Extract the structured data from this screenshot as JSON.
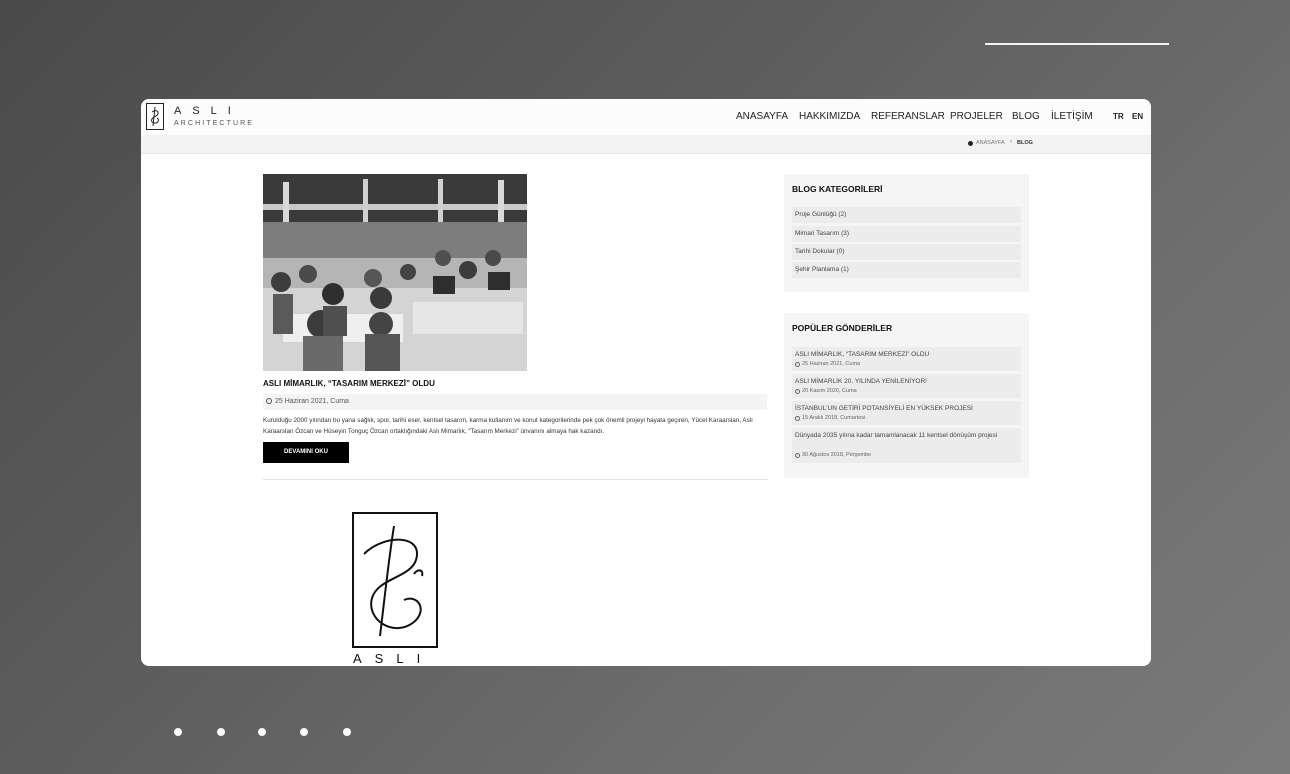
{
  "header": {
    "logo_name": "ASLI",
    "logo_sub": "ARCHITECTURE",
    "nav": [
      "ANASAYFA",
      "HAKKIMIZDA",
      "REFERANSLAR",
      "PROJELER",
      "BLOG",
      "İLETİŞİM"
    ],
    "languages": [
      "TR",
      "EN"
    ]
  },
  "breadcrumb": {
    "home": "ANASAYFA",
    "separator": "›",
    "current": "BLOG"
  },
  "post": {
    "title": "ASLI MİMARLIK, “TASARIM MERKEZİ” OLDU",
    "date": "25 Haziran 2021, Cuma",
    "excerpt": "Kurulduğu 2000 yılından bu yana sağlık, spor, tarihi eser, kentsel tasarım, karma kullanım ve konut kategorilerinde pek çok önemli projeyi hayata geçiren, Yücel Karaarslan, Aslı Karaarslan Özcan ve Hüseyin Tonguç Özcan ortaklığındaki Aslı Mimarlık, “Tasarım Merkezi” ünvanını almaya hak kazandı.",
    "read_more": "DEVAMINI OKU"
  },
  "big_logo": {
    "name": "ASLI"
  },
  "sidebar": {
    "categories_title": "BLOG KATEGORİLERİ",
    "categories": [
      "Proje Günlüğü (2)",
      "Mimari Tasarım (3)",
      "Tarihi Dokular (0)",
      "Şehir Planlama (1)"
    ],
    "popular_title": "POPÜLER GÖNDERİLER",
    "popular": [
      {
        "title": "ASLI MİMARLIK, “TASARIM MERKEZİ” OLDU",
        "date": "25 Haziran 2021, Cuma"
      },
      {
        "title": "ASLI MİMARLIK 20. YILINDA YENİLENİYOR!",
        "date": "20 Kasım 2020, Cuma"
      },
      {
        "title": "İSTANBUL'UN GETİRİ POTANSİYELİ EN YÜKSEK PROJESİ",
        "date": "15 Aralık 2018, Cumartesi"
      },
      {
        "title": "Dünyada 2035 yılına kadar tamamlanacak 11 kentsel dönüşüm projesi",
        "date": "30 Ağustos 2018, Perşembe"
      }
    ]
  },
  "carousel": {
    "dot_count": 5
  },
  "colors": {
    "background": "#5d5d5d",
    "accent": "#000000",
    "panel": "#f5f5f5"
  }
}
